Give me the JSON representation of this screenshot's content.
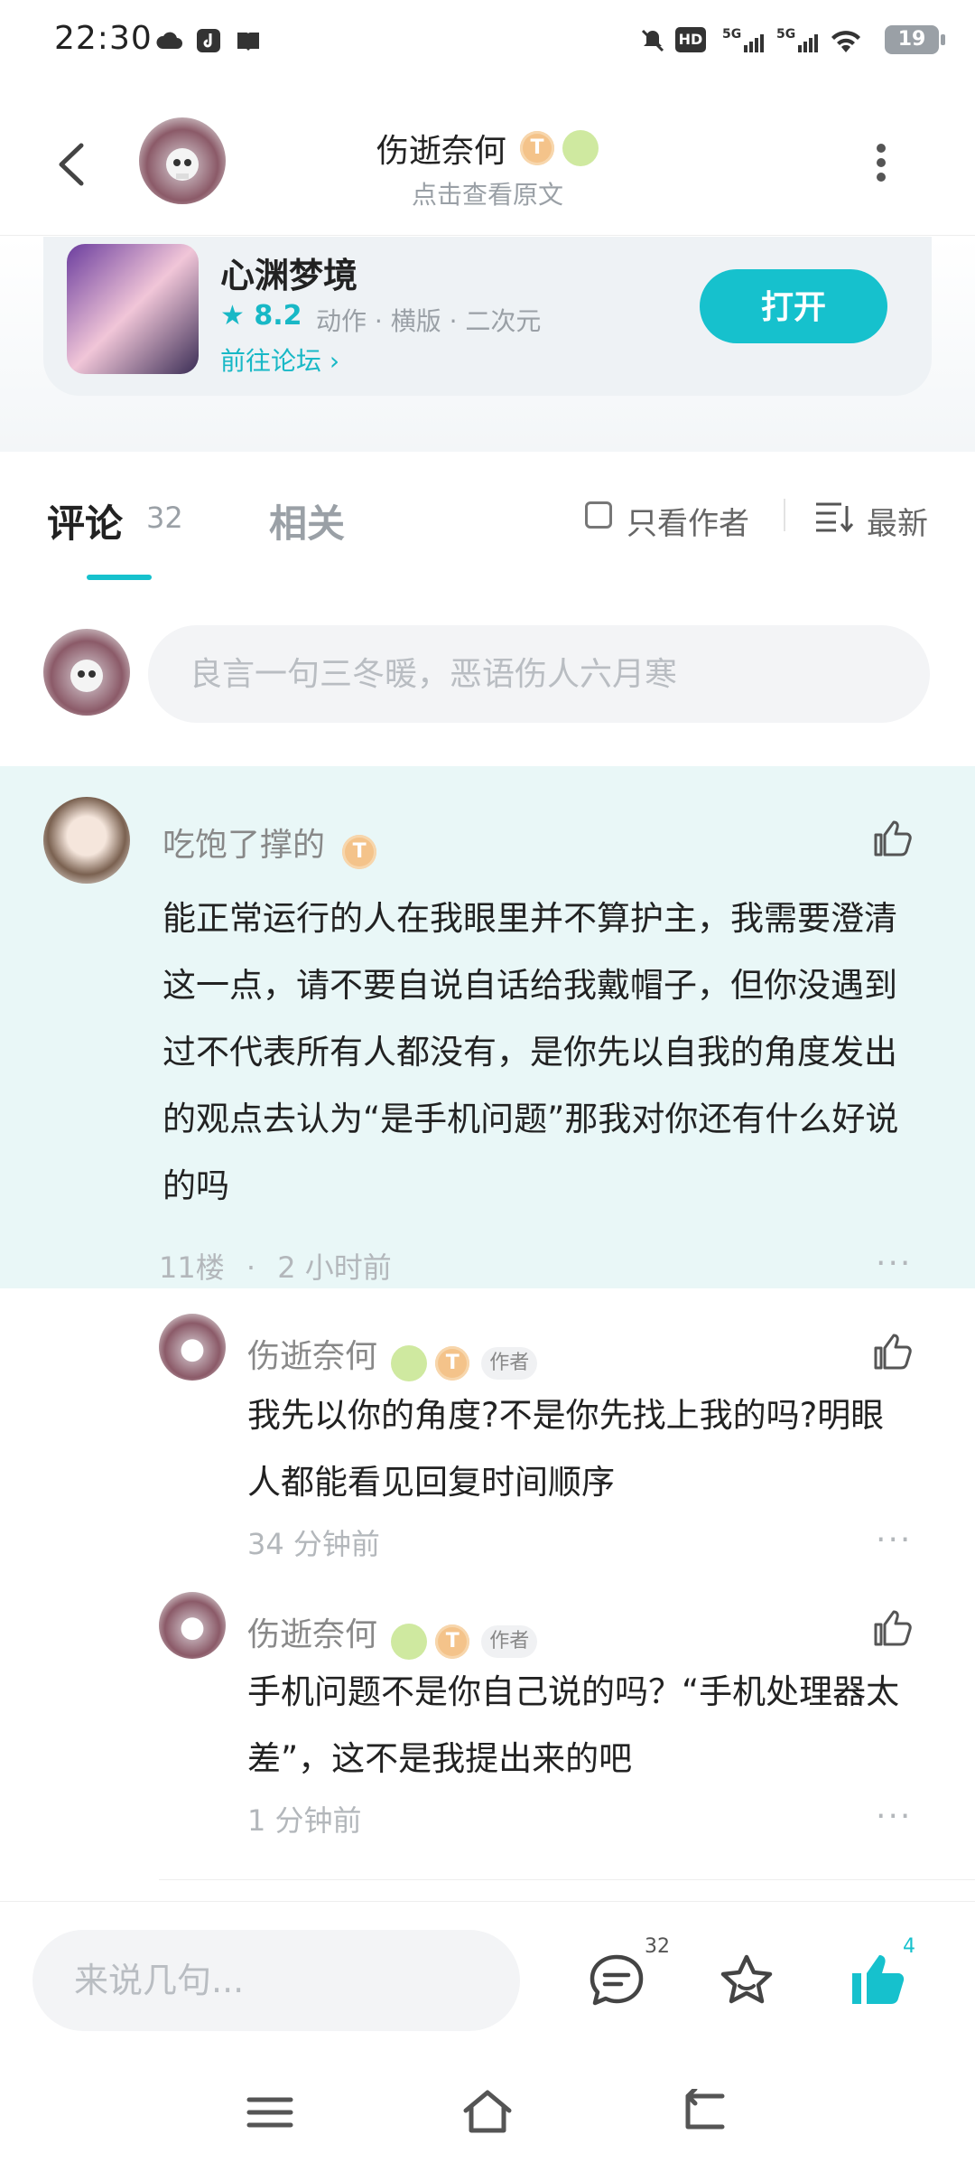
{
  "status_bar": {
    "time": "22:30",
    "battery": "19"
  },
  "header": {
    "title": "伤逝奈何",
    "subtitle": "点击查看原文",
    "badge_level": "T"
  },
  "game": {
    "name": "心渊梦境",
    "rating": "8.2",
    "tags": "动作 · 横版 · 二次元",
    "forum_link": "前往论坛",
    "open_button": "打开"
  },
  "tabs": {
    "comments_label": "评论",
    "comments_count": "32",
    "related_label": "相关",
    "author_only": "只看作者",
    "sort": "最新"
  },
  "comment_input": {
    "placeholder": "良言一句三冬暖，恶语伤人六月寒"
  },
  "main_comment": {
    "username": "吃饱了撑的",
    "content": "能正常运行的人在我眼里并不算护主，我需要澄清这一点，请不要自说自话给我戴帽子，但你没遇到过不代表所有人都没有，是你先以自我的角度发出的观点去认为“是手机问题”那我对你还有什么好说的吗",
    "floor": "11楼",
    "time": "2 小时前"
  },
  "replies": [
    {
      "username": "伤逝奈何",
      "author_tag": "作者",
      "content": "我先以你的角度?不是你先找上我的吗?明眼人都能看见回复时间顺序",
      "time": "34 分钟前"
    },
    {
      "username": "伤逝奈何",
      "author_tag": "作者",
      "content": "手机问题不是你自己说的吗？“手机处理器太差”，这不是我提出来的吧",
      "time": "1 分钟前"
    }
  ],
  "bottom_bar": {
    "placeholder": "来说几句...",
    "comment_count": "32",
    "like_count": "4"
  },
  "colors": {
    "accent": "#16c1cd",
    "highlight_bg": "#e9f7f7",
    "gold_badge": "#f4c38a"
  },
  "icons": [
    "back-icon",
    "more-vert-icon",
    "star-icon",
    "chevron-right-icon",
    "checkbox-icon",
    "sort-icon",
    "like-icon",
    "comment-icon",
    "favorite-icon",
    "menu-icon",
    "home-icon",
    "back-nav-icon"
  ]
}
